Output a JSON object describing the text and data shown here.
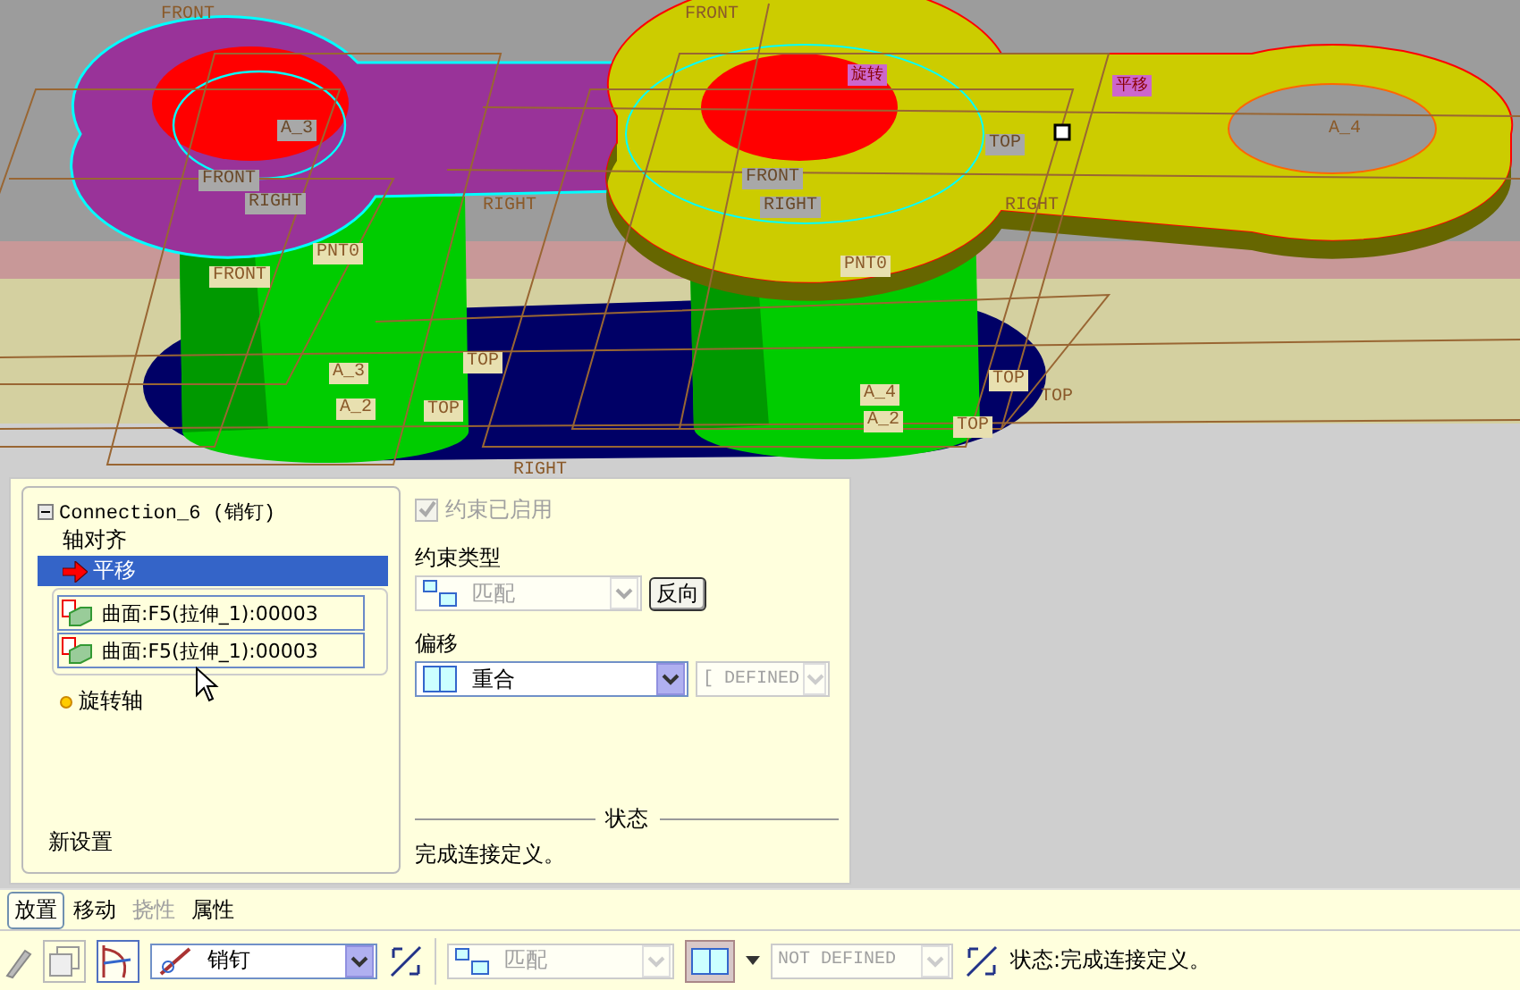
{
  "viewport": {
    "labels": [
      {
        "text": "FRONT",
        "kind": "plain"
      },
      {
        "text": "FRONT",
        "kind": "plain"
      },
      {
        "text": "A_3",
        "kind": "grey"
      },
      {
        "text": "FRONT",
        "kind": "grey"
      },
      {
        "text": "RIGHT",
        "kind": "grey"
      },
      {
        "text": "RIGHT",
        "kind": "plain"
      },
      {
        "text": "PNT0",
        "kind": "tan"
      },
      {
        "text": "FRONT",
        "kind": "tan"
      },
      {
        "text": "TOP",
        "kind": "tan"
      },
      {
        "text": "A_3",
        "kind": "tan"
      },
      {
        "text": "A_2",
        "kind": "tan"
      },
      {
        "text": "TOP",
        "kind": "tan"
      },
      {
        "text": "旋转",
        "kind": "magenta"
      },
      {
        "text": "平移",
        "kind": "magenta"
      },
      {
        "text": "TOP",
        "kind": "grey"
      },
      {
        "text": "FRONT",
        "kind": "grey"
      },
      {
        "text": "RIGHT",
        "kind": "grey"
      },
      {
        "text": "RIGHT",
        "kind": "plain"
      },
      {
        "text": "A_4",
        "kind": "plain"
      },
      {
        "text": "PNT0",
        "kind": "tan"
      },
      {
        "text": "A_4",
        "kind": "tan"
      },
      {
        "text": "TOP",
        "kind": "tan"
      },
      {
        "text": "TOP",
        "kind": "plain"
      },
      {
        "text": "A_2",
        "kind": "tan"
      },
      {
        "text": "TOP",
        "kind": "tan"
      },
      {
        "text": "RIGHT",
        "kind": "plain"
      }
    ]
  },
  "panel": {
    "tree": {
      "root": {
        "label": "Connection_6 (销钉)",
        "expanded": true
      },
      "items": [
        {
          "label": "轴对齐",
          "kind": "plain",
          "selected": false
        },
        {
          "label": "平移",
          "kind": "arrow",
          "selected": true
        },
        {
          "label": "曲面:F5(拉伸_1):00003",
          "kind": "reference",
          "selected": false
        },
        {
          "label": "曲面:F5(拉伸_1):00003",
          "kind": "reference",
          "selected": false
        },
        {
          "label": "旋转轴",
          "kind": "dot",
          "selected": false
        }
      ],
      "new_setting": "新设置"
    },
    "enabled": {
      "label": "约束已启用",
      "checked": true,
      "disabled": true
    },
    "constraint_type": {
      "label": "约束类型",
      "value": "匹配",
      "disabled": true
    },
    "flip_button": "反向",
    "offset": {
      "label": "偏移",
      "value": "重合"
    },
    "offset_value": {
      "value": "[ DEFINED",
      "disabled": true
    },
    "status": {
      "title": "状态",
      "text": "完成连接定义。"
    }
  },
  "tabs": [
    {
      "label": "放置",
      "selected": true,
      "disabled": false
    },
    {
      "label": "移动",
      "selected": false,
      "disabled": false
    },
    {
      "label": "挠性",
      "selected": false,
      "disabled": true
    },
    {
      "label": "属性",
      "selected": false,
      "disabled": false
    }
  ],
  "toolbar": {
    "connection_type": "销钉",
    "constraint": {
      "value": "匹配",
      "disabled": true
    },
    "offset_value": {
      "value": "NOT DEFINED",
      "disabled": true
    },
    "status": "状态:完成连接定义。"
  }
}
